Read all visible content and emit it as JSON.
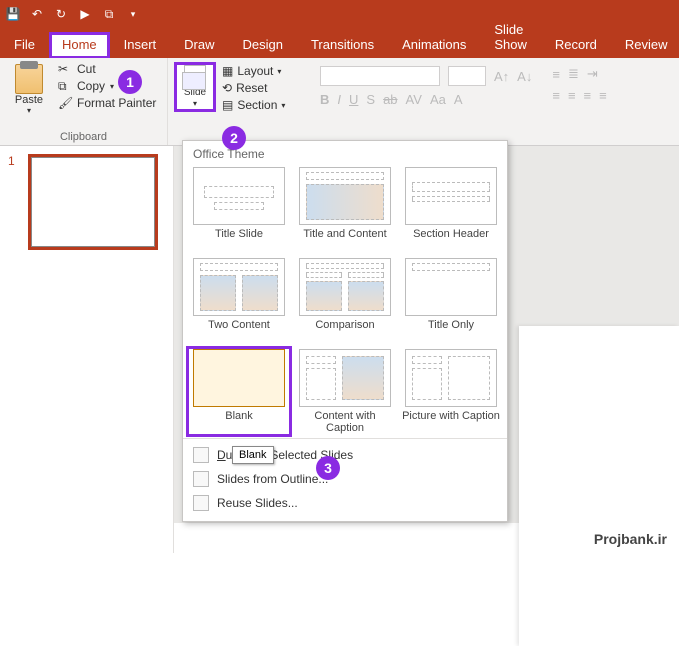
{
  "qat_icons": [
    "save",
    "undo",
    "redo",
    "slideshow",
    "window"
  ],
  "tabs": [
    "File",
    "Home",
    "Insert",
    "Draw",
    "Design",
    "Transitions",
    "Animations",
    "Slide Show",
    "Record",
    "Review"
  ],
  "active_tab": "Home",
  "clipboard": {
    "paste": "Paste",
    "cut": "Cut",
    "copy": "Copy",
    "format_painter": "Format Painter",
    "group_label": "Clipboard"
  },
  "slides": {
    "new_slide": "New Slide",
    "layout": "Layout",
    "reset": "Reset",
    "section": "Section"
  },
  "font_buttons": [
    "B",
    "I",
    "U",
    "S",
    "ab",
    "AV",
    "Aa",
    "A"
  ],
  "badges": {
    "b1": "1",
    "b2": "2",
    "b3": "3"
  },
  "slide_number": "1",
  "dropdown": {
    "header": "Office Theme",
    "layouts": [
      {
        "name": "Title Slide"
      },
      {
        "name": "Title and Content"
      },
      {
        "name": "Section Header"
      },
      {
        "name": "Two Content"
      },
      {
        "name": "Comparison"
      },
      {
        "name": "Title Only"
      },
      {
        "name": "Blank"
      },
      {
        "name": "Content with Caption"
      },
      {
        "name": "Picture with Caption"
      }
    ],
    "tooltip": "Blank",
    "menu": {
      "duplicate": "Duplicate Selected Slides",
      "from_outline": "Slides from Outline...",
      "reuse": "Reuse Slides..."
    }
  },
  "watermark": "Projbank.ir"
}
